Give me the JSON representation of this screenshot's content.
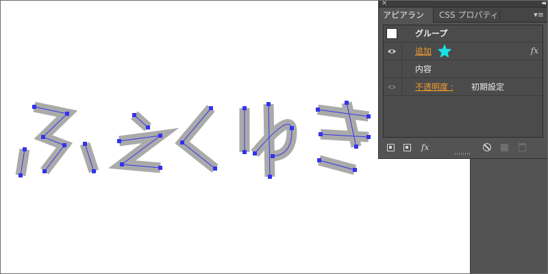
{
  "panel": {
    "close_glyph": "×",
    "collapse_glyph": "◂◂",
    "tabs": [
      {
        "label": "アピアランス",
        "active": true
      },
      {
        "label": "CSS プロパティ",
        "active": false
      }
    ],
    "menu_glyph": "▾≡",
    "rows": {
      "group": {
        "label": "グループ"
      },
      "add": {
        "label": "追加",
        "fx": "fx",
        "star_color": "#19e0e6"
      },
      "contents": {
        "label": "内容"
      },
      "opacity": {
        "label": "不透明度 :",
        "value": "初期設定"
      }
    },
    "footer": {
      "fx_label": "fx"
    }
  },
  "artwork": {
    "text": "ふぇくゆき",
    "stroke_color": "#aaaaaa",
    "path_color": "#3333ee"
  }
}
